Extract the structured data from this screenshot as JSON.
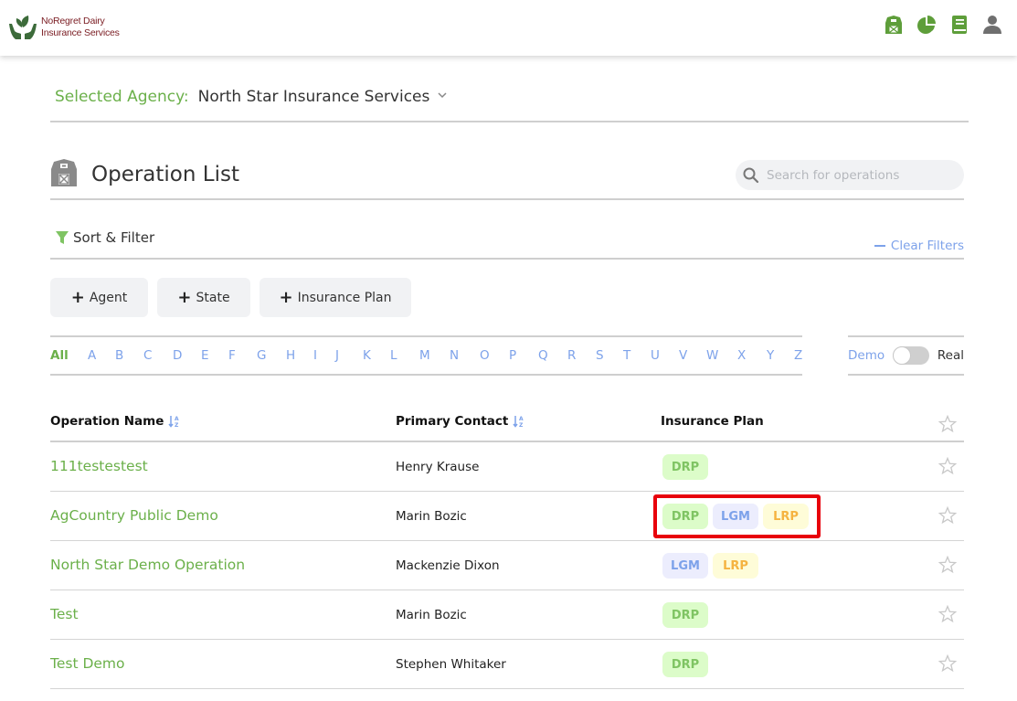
{
  "header": {
    "logo_line1": "NoRegret Dairy",
    "logo_line2": "Insurance Services",
    "icons": [
      "barn-icon",
      "pie-chart-icon",
      "book-icon",
      "user-icon"
    ]
  },
  "agency": {
    "label": "Selected Agency:",
    "value": "North Star Insurance Services"
  },
  "operation_list": {
    "title": "Operation List",
    "search_placeholder": "Search for operations",
    "search_value": ""
  },
  "sort_filter": {
    "label": "Sort & Filter",
    "clear_label": "Clear Filters",
    "buttons": [
      "Agent",
      "State",
      "Insurance Plan"
    ]
  },
  "alphabet": {
    "active": "All",
    "letters": [
      "All",
      "A",
      "B",
      "C",
      "D",
      "E",
      "F",
      "G",
      "H",
      "I",
      "J",
      "K",
      "L",
      "M",
      "N",
      "O",
      "P",
      "Q",
      "R",
      "S",
      "T",
      "U",
      "V",
      "W",
      "X",
      "Y",
      "Z"
    ]
  },
  "toggle": {
    "left_label": "Demo",
    "right_label": "Real",
    "state": "Demo"
  },
  "table": {
    "headers": {
      "name": "Operation Name",
      "contact": "Primary Contact",
      "plan": "Insurance Plan"
    },
    "rows": [
      {
        "name": "111testestest",
        "contact": "Henry Krause",
        "plans": [
          "DRP"
        ]
      },
      {
        "name": "AgCountry Public Demo",
        "contact": "Marin Bozic",
        "plans": [
          "DRP",
          "LGM",
          "LRP"
        ]
      },
      {
        "name": "North Star Demo Operation",
        "contact": "Mackenzie Dixon",
        "plans": [
          "LGM",
          "LRP"
        ]
      },
      {
        "name": "Test",
        "contact": "Marin Bozic",
        "plans": [
          "DRP"
        ]
      },
      {
        "name": "Test Demo",
        "contact": "Stephen Whitaker",
        "plans": [
          "DRP"
        ]
      }
    ]
  },
  "colors": {
    "brand_green": "#6bb04a",
    "link_blue": "#7da2ea",
    "logo_red": "#7a1c22",
    "highlight_red": "#e8000b"
  }
}
